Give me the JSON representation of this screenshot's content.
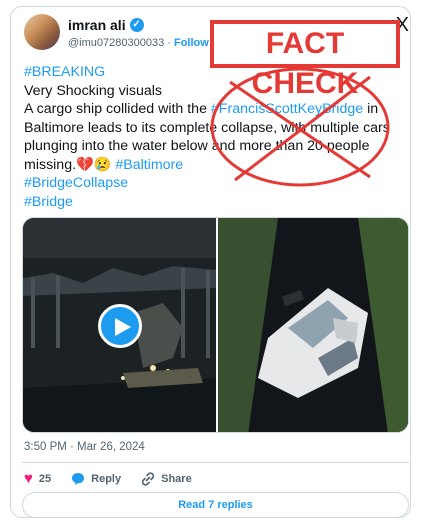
{
  "header": {
    "display_name": "imran ali",
    "handle": "@imu07280300033",
    "separator": "·",
    "follow_label": "Follow",
    "close_glyph": "X"
  },
  "annotation": {
    "stamp_text": "FACT CHECK",
    "stamp_color": "#e53935"
  },
  "tweet": {
    "line1": "#BREAKING",
    "line2": "Very Shocking visuals",
    "line3": "A cargo ship collided with the ",
    "line3_tag": "#FrancisScottKeyBridge",
    "line3_end": " in",
    "line4": "Baltimore leads to its complete collapse, with multiple cars",
    "line5": "plunging into the water below and more than 20 people",
    "line6": "missing.",
    "line6_emoji": "💔😢",
    "line6_tag": "#Baltimore",
    "line7": "#BridgeCollapse",
    "line8": "#Bridge"
  },
  "media": {
    "left": "video-bridge-collapse-night",
    "right": "photo-car-in-river",
    "play_icon": "play-icon"
  },
  "meta": {
    "timestamp": "3:50 PM · Mar 26, 2024"
  },
  "actions": {
    "like_count": "25",
    "reply_label": "Reply",
    "share_label": "Share"
  },
  "replies": {
    "label": "Read 7 replies"
  },
  "colors": {
    "accent": "#1d9bf0",
    "like": "#f91880",
    "text": "#0f1419",
    "muted": "#536471",
    "border": "#cfd9de"
  }
}
